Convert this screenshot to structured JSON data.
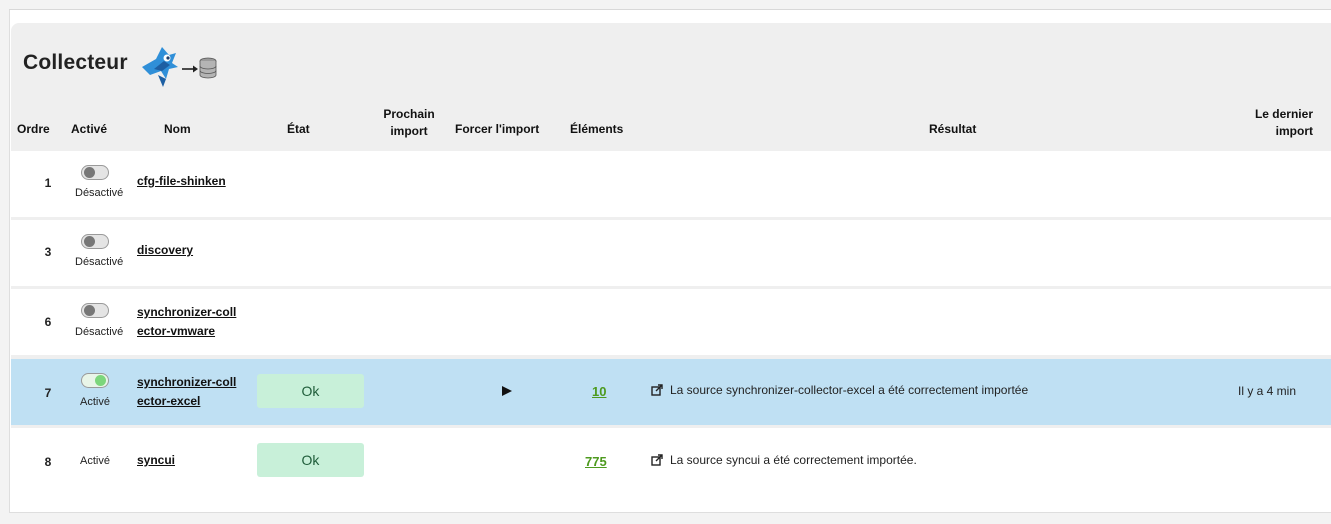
{
  "title": "Collecteur",
  "columns": {
    "ordre": "Ordre",
    "active": "Activé",
    "nom": "Nom",
    "etat": "État",
    "prochain_1": "Prochain",
    "prochain_2": "import",
    "forcer": "Forcer l'import",
    "elements": "Éléments",
    "resultat": "Résultat",
    "dernier_1": "Le dernier",
    "dernier_2": "import"
  },
  "rows": [
    {
      "ordre": "1",
      "status": "Désactivé",
      "toggle": "off",
      "name_1": "cfg-file-shinken",
      "name_2": ""
    },
    {
      "ordre": "3",
      "status": "Désactivé",
      "toggle": "off",
      "name_1": "discovery",
      "name_2": ""
    },
    {
      "ordre": "6",
      "status": "Désactivé",
      "toggle": "off",
      "name_1": "synchronizer-coll",
      "name_2": "ector-vmware"
    },
    {
      "ordre": "7",
      "status": "Activé",
      "toggle": "on",
      "name_1": "synchronizer-coll",
      "name_2": "ector-excel",
      "etat": "Ok",
      "elements": "10",
      "resultat": "La source synchronizer-collector-excel a été correctement importée",
      "dernier": "Il y a 4 min"
    },
    {
      "ordre": "8",
      "status": "Activé",
      "toggle": "none",
      "name_1": "syncui",
      "name_2": "",
      "etat": "Ok",
      "elements": "775",
      "resultat": "La source syncui a été correctement importée."
    }
  ],
  "colors": {
    "selected_row": "#bfe0f3",
    "ok_badge": "#c8f0d9",
    "count_link": "#4d9a1e"
  }
}
